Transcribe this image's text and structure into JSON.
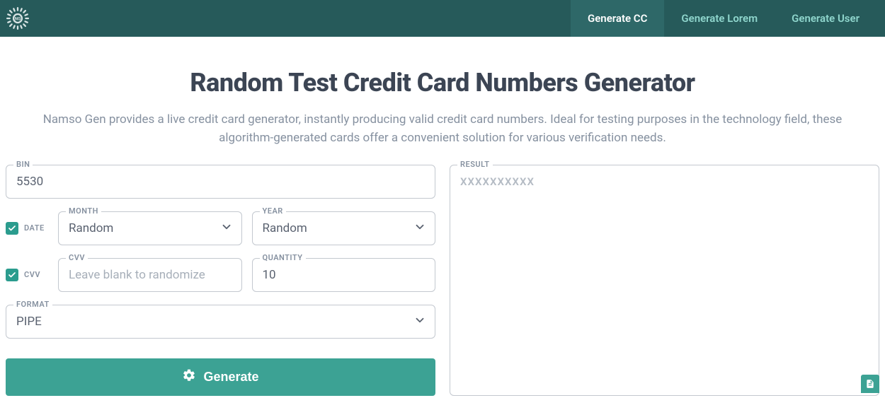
{
  "nav": {
    "items": [
      {
        "label": "Generate CC",
        "active": true
      },
      {
        "label": "Generate Lorem",
        "active": false
      },
      {
        "label": "Generate User",
        "active": false
      }
    ]
  },
  "page": {
    "title": "Random Test Credit Card Numbers Generator",
    "description": "Namso Gen provides a live credit card generator, instantly producing valid credit card numbers. Ideal for testing purposes in the technology field, these algorithm-generated cards offer a convenient solution for various verification needs."
  },
  "form": {
    "bin": {
      "label": "BIN",
      "value": "5530"
    },
    "date_toggle": {
      "label": "DATE",
      "checked": true
    },
    "month": {
      "label": "MONTH",
      "value": "Random"
    },
    "year": {
      "label": "YEAR",
      "value": "Random"
    },
    "cvv_toggle": {
      "label": "CVV",
      "checked": true
    },
    "cvv": {
      "label": "CVV",
      "placeholder": "Leave blank to randomize",
      "value": ""
    },
    "quantity": {
      "label": "QUANTITY",
      "value": "10"
    },
    "format": {
      "label": "FORMAT",
      "value": "PIPE"
    },
    "generate_label": "Generate"
  },
  "result": {
    "label": "RESULT",
    "placeholder": "XXXXXXXXXX"
  }
}
